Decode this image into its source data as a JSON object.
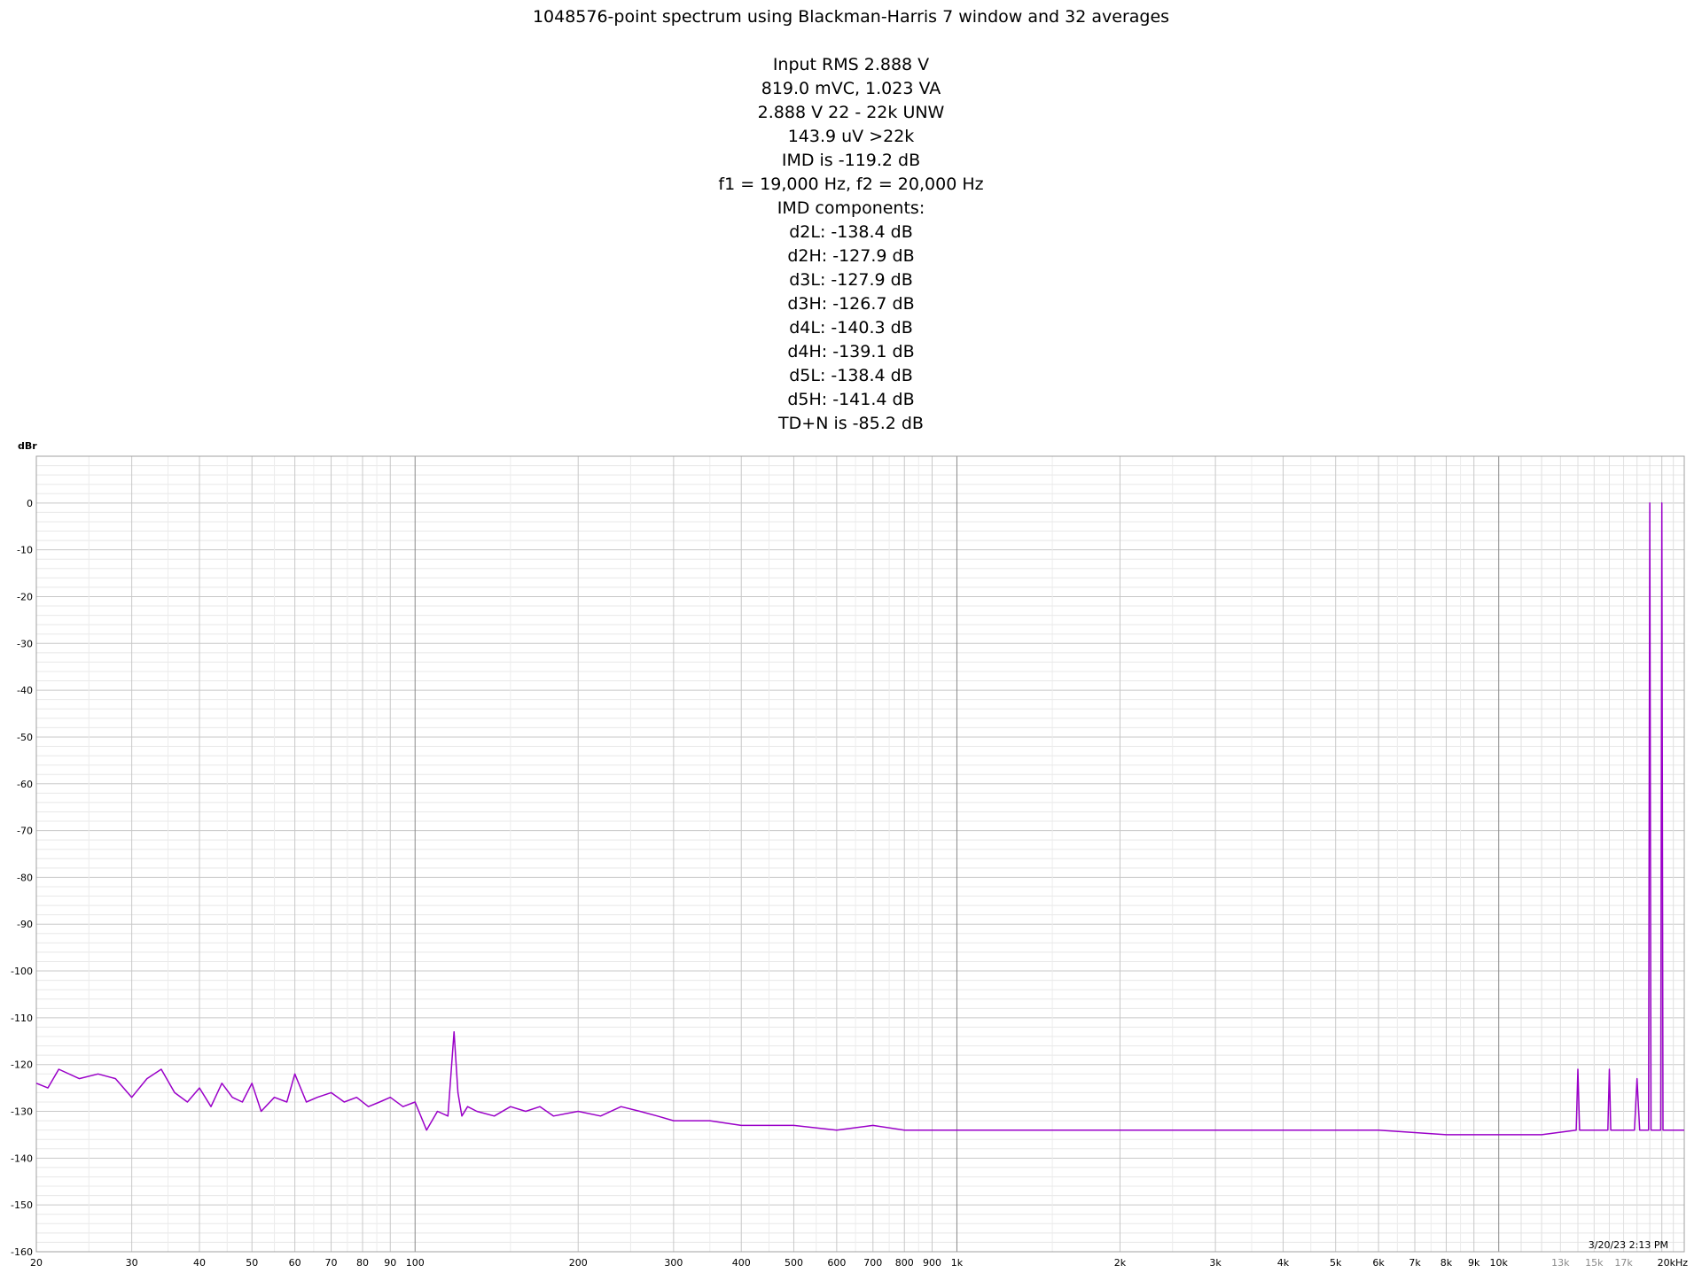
{
  "header": {
    "title": "1048576-point spectrum using Blackman-Harris 7 window and 32 averages",
    "lines": [
      "Input RMS 2.888 V",
      "819.0 mVC, 1.023 VA",
      "2.888 V 22 - 22k UNW",
      "143.9 uV >22k",
      "IMD is -119.2 dB",
      "f1 = 19,000 Hz, f2 = 20,000 Hz",
      "IMD components:",
      "d2L: -138.4 dB",
      "d2H: -127.9 dB",
      "d3L: -127.9 dB",
      "d3H: -126.7 dB",
      "d4L: -140.3 dB",
      "d4H: -139.1 dB",
      "d5L: -138.4 dB",
      "d5H: -141.4 dB",
      "TD+N is -85.2 dB"
    ]
  },
  "chart_data": {
    "type": "line",
    "ylabel": "dBr",
    "timestamp": "3/20/23 2:13 PM",
    "xscale": "log",
    "xlim": [
      20,
      22000
    ],
    "ylim": [
      -160,
      10
    ],
    "grid": true,
    "y_ticks": [
      {
        "v": 0,
        "label": "0"
      },
      {
        "v": -10,
        "label": "-10"
      },
      {
        "v": -20,
        "label": "-20"
      },
      {
        "v": -30,
        "label": "-30"
      },
      {
        "v": -40,
        "label": "-40"
      },
      {
        "v": -50,
        "label": "-50"
      },
      {
        "v": -60,
        "label": "-60"
      },
      {
        "v": -70,
        "label": "-70"
      },
      {
        "v": -80,
        "label": "-80"
      },
      {
        "v": -90,
        "label": "-90"
      },
      {
        "v": -100,
        "label": "-100"
      },
      {
        "v": -110,
        "label": "-110"
      },
      {
        "v": -120,
        "label": "-120"
      },
      {
        "v": -130,
        "label": "-130"
      },
      {
        "v": -140,
        "label": "-140"
      },
      {
        "v": -150,
        "label": "-150"
      },
      {
        "v": -160,
        "label": "-160"
      }
    ],
    "x_ticks": [
      {
        "v": 20,
        "label": "20"
      },
      {
        "v": 30,
        "label": "30"
      },
      {
        "v": 40,
        "label": "40"
      },
      {
        "v": 50,
        "label": "50"
      },
      {
        "v": 60,
        "label": "60"
      },
      {
        "v": 70,
        "label": "70"
      },
      {
        "v": 80,
        "label": "80"
      },
      {
        "v": 90,
        "label": "90"
      },
      {
        "v": 100,
        "label": "100"
      },
      {
        "v": 200,
        "label": "200"
      },
      {
        "v": 300,
        "label": "300"
      },
      {
        "v": 400,
        "label": "400"
      },
      {
        "v": 500,
        "label": "500"
      },
      {
        "v": 600,
        "label": "600"
      },
      {
        "v": 700,
        "label": "700"
      },
      {
        "v": 800,
        "label": "800"
      },
      {
        "v": 900,
        "label": "900"
      },
      {
        "v": 1000,
        "label": "1k"
      },
      {
        "v": 2000,
        "label": "2k"
      },
      {
        "v": 3000,
        "label": "3k"
      },
      {
        "v": 4000,
        "label": "4k"
      },
      {
        "v": 5000,
        "label": "5k"
      },
      {
        "v": 6000,
        "label": "6k"
      },
      {
        "v": 7000,
        "label": "7k"
      },
      {
        "v": 8000,
        "label": "8k"
      },
      {
        "v": 9000,
        "label": "9k"
      },
      {
        "v": 10000,
        "label": "10k"
      },
      {
        "v": 13000,
        "label": "13k",
        "muted": true
      },
      {
        "v": 15000,
        "label": "15k",
        "muted": true
      },
      {
        "v": 17000,
        "label": "17k",
        "muted": true
      },
      {
        "v": 22000,
        "label": "20kHz"
      }
    ],
    "series": [
      {
        "color": "#9a00c8",
        "x": [
          20,
          21,
          22,
          24,
          26,
          28,
          30,
          32,
          34,
          36,
          38,
          40,
          42,
          44,
          46,
          48,
          50,
          52,
          55,
          58,
          60,
          63,
          66,
          70,
          74,
          78,
          82,
          86,
          90,
          95,
          100,
          105,
          110,
          115,
          118,
          120,
          122,
          125,
          130,
          140,
          150,
          160,
          170,
          180,
          200,
          220,
          240,
          260,
          280,
          300,
          350,
          400,
          500,
          600,
          700,
          800,
          1000,
          1500,
          2000,
          3000,
          4000,
          5000,
          6000,
          8000,
          10000,
          12000,
          13900,
          14000,
          14100,
          15900,
          16000,
          16100,
          17800,
          18000,
          18200,
          18900,
          19000,
          19100,
          19900,
          20000,
          20100,
          22000
        ],
        "y": [
          -124,
          -125,
          -121,
          -123,
          -122,
          -123,
          -127,
          -123,
          -121,
          -126,
          -128,
          -125,
          -129,
          -124,
          -127,
          -128,
          -124,
          -130,
          -127,
          -128,
          -122,
          -128,
          -127,
          -126,
          -128,
          -127,
          -129,
          -128,
          -127,
          -129,
          -128,
          -134,
          -130,
          -131,
          -113,
          -126,
          -131,
          -129,
          -130,
          -131,
          -129,
          -130,
          -129,
          -131,
          -130,
          -131,
          -129,
          -130,
          -131,
          -132,
          -132,
          -133,
          -133,
          -134,
          -133,
          -134,
          -134,
          -134,
          -134,
          -134,
          -134,
          -134,
          -134,
          -135,
          -135,
          -135,
          -134,
          -121,
          -134,
          -134,
          -121,
          -134,
          -134,
          -123,
          -134,
          -134,
          0,
          -134,
          -134,
          0,
          -134,
          -134
        ]
      }
    ]
  }
}
